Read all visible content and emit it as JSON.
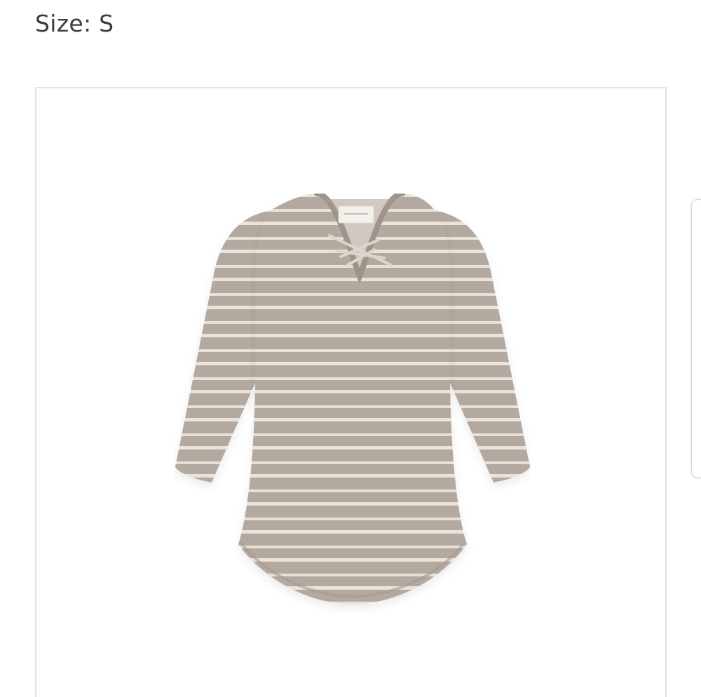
{
  "product": {
    "size_label": "Size: S",
    "image_icon": "striped-top-image",
    "colors": {
      "heather": "#b4a9a0",
      "stripe": "#e9e3da",
      "frame_border": "#e4e2de"
    }
  }
}
